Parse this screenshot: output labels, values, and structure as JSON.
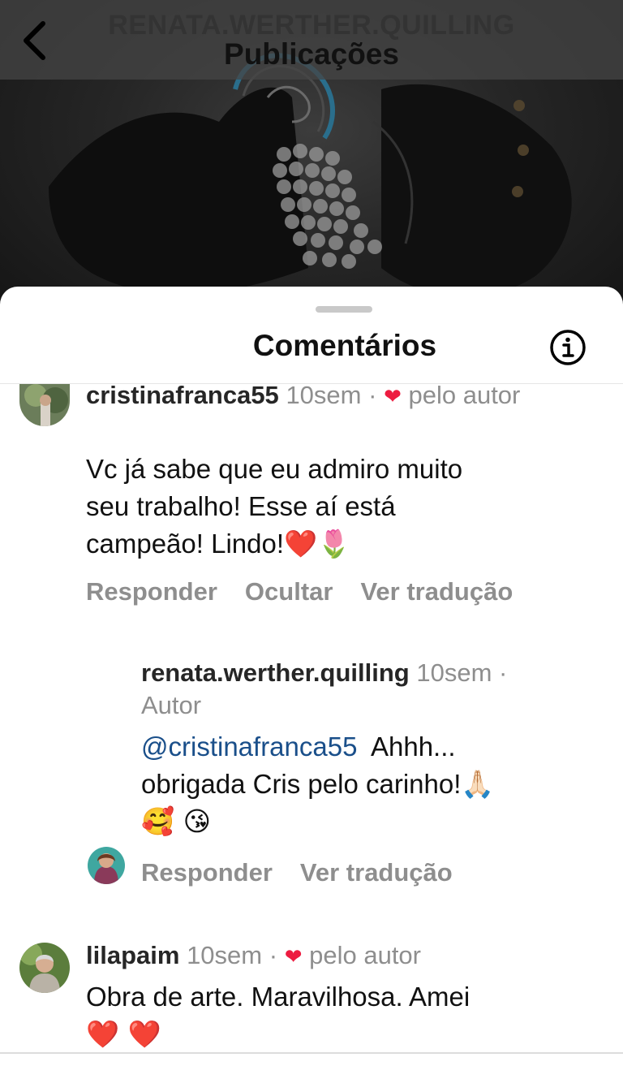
{
  "header": {
    "username": "RENATA.WERTHER.QUILLING",
    "title": "Publicações",
    "back_icon": "chevron-left-icon"
  },
  "sheet": {
    "title": "Comentários",
    "info_icon": "info-icon"
  },
  "comments": [
    {
      "username": "cristinafranca55",
      "time": "10sem",
      "separator": "·",
      "liked_by_author": "pelo autor",
      "text_line1": "Vc já sabe que eu admiro muito",
      "text_line2": "seu trabalho! Esse aí está",
      "text_line3": "campeão! Lindo!",
      "emoji": "❤️🌷",
      "actions": {
        "reply": "Responder",
        "hide": "Ocultar",
        "translate": "Ver tradução"
      }
    },
    {
      "username": "renata.werther.quilling",
      "time": "10sem",
      "separator": "·",
      "role": "Autor",
      "mention": "@cristinafranca55",
      "text_line1": "Ahhh...",
      "text_line2": "obrigada Cris pelo carinho!",
      "emoji1": "🙏🏻",
      "emoji2": "🥰 😘",
      "actions": {
        "reply": "Responder",
        "translate": "Ver tradução"
      }
    },
    {
      "username": "lilapaim",
      "time": "10sem",
      "separator": "·",
      "liked_by_author": "pelo autor",
      "text_line1": "Obra de arte. Maravilhosa. Amei",
      "emoji": "❤️ ❤️"
    }
  ],
  "colors": {
    "like_heart": "#ed1c40",
    "mention": "#1a4f8a",
    "meta_gray": "#8e8e8e"
  }
}
